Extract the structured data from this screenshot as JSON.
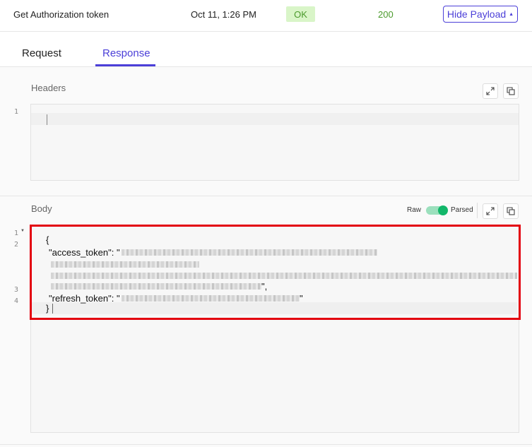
{
  "request": {
    "name": "Get Authorization token",
    "time": "Oct 11, 1:26 PM",
    "status_text": "OK",
    "status_code": "200",
    "hide_payload_label": "Hide Payload",
    "caret": "▲"
  },
  "tabs": [
    {
      "label": "Request",
      "active": false
    },
    {
      "label": "Response",
      "active": true
    }
  ],
  "headers_section": {
    "label": "Headers",
    "line_numbers": [
      "1"
    ]
  },
  "body_section": {
    "label": "Body",
    "raw_label": "Raw",
    "parsed_label": "Parsed",
    "toggle_parsed": true,
    "line_numbers": [
      "1",
      "2",
      "3",
      "4"
    ],
    "fold_glyph": "▼",
    "code": {
      "open_brace": "{",
      "access_key": "\"access_token\": \"",
      "access_suffix": "\",",
      "refresh_key": "\"refresh_token\": \"",
      "refresh_suffix": "\"",
      "close_brace": "}"
    }
  },
  "colors": {
    "accent": "#4b3fd8",
    "ok_green": "#4a9a2b",
    "ok_bg": "#d9f5c8",
    "toggle_on": "#12b76a",
    "highlight_red": "#e3000f"
  },
  "icons": [
    "expand-icon",
    "copy-icon"
  ]
}
